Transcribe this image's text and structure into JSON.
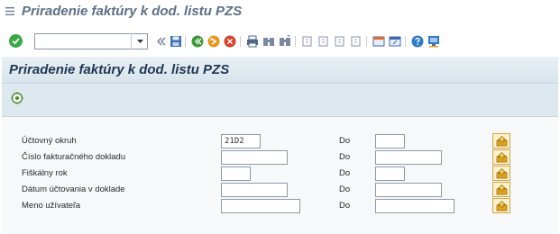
{
  "window": {
    "title": "Priradenie faktúry k dod. listu PZS"
  },
  "toolbar": {
    "command_value": "",
    "icons": [
      "enter-icon",
      "command-field",
      "history-back-icon",
      "save-icon",
      "back-icon",
      "exit-icon",
      "cancel-icon",
      "print-icon",
      "find-icon",
      "find-next-icon",
      "first-page-icon",
      "previous-page-icon",
      "next-page-icon",
      "last-page-icon",
      "create-session-icon",
      "shortcut-icon",
      "help-icon",
      "customize-layout-icon"
    ]
  },
  "screen": {
    "title": "Priradenie faktúry k dod. listu PZS",
    "execute_icon": "execute-icon"
  },
  "selection": {
    "rows": [
      {
        "label": "Účtovný okruh",
        "from": "21D2",
        "to_label": "Do",
        "to": ""
      },
      {
        "label": "Číslo fakturačného dokladu",
        "from": "",
        "to_label": "Do",
        "to": ""
      },
      {
        "label": "Fiškálny rok",
        "from": "",
        "to_label": "Do",
        "to": ""
      },
      {
        "label": "Dátum účtovania v doklade",
        "from": "",
        "to_label": "Do",
        "to": ""
      },
      {
        "label": "Meno užívateľa",
        "from": "",
        "to_label": "Do",
        "to": ""
      }
    ]
  },
  "colors": {
    "title": "#5e6f86",
    "screen_title": "#1f3653",
    "ok_green": "#39a845",
    "panel_bg": "#f6f8fa",
    "header_bg": "#dde8ef"
  }
}
